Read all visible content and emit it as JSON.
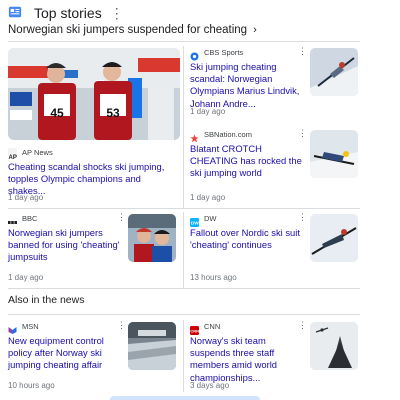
{
  "header": {
    "title": "Top stories",
    "topic": "Norwegian ski jumpers suspended for cheating",
    "chevron": "›"
  },
  "top_cards": [
    {
      "source": "AP News",
      "headline": "Cheating scandal shocks ski jumping, topples Olympic champions and shakes...",
      "time": "1 day ago",
      "bibs": [
        "45",
        "53"
      ]
    },
    {
      "source": "CBS Sports",
      "headline": "Ski jumping cheating scandal: Norwegian Olympians Marius Lindvik, Johann Andre...",
      "time": "1 day ago"
    },
    {
      "source": "SBNation.com",
      "headline": "Blatant CROTCH CHEATING has rocked the ski jumping world",
      "time": "1 day ago"
    },
    {
      "source": "BBC",
      "headline": "Norwegian ski jumpers banned for using 'cheating' jumpsuits",
      "time": "1 day ago"
    },
    {
      "source": "DW",
      "headline": "Fallout over Nordic ski suit 'cheating' continues",
      "time": "13 hours ago"
    }
  ],
  "also_title": "Also in the news",
  "also_cards": [
    {
      "source": "MSN",
      "headline": "New equipment control policy after Norway ski jumping cheating affair",
      "time": "10 hours ago"
    },
    {
      "source": "CNN",
      "headline": "Norway's ski team suspends three staff members amid world championships...",
      "time": "3 days ago"
    }
  ],
  "icons": {
    "kebab": "⋮",
    "news": "newspaper-icon"
  },
  "colors": {
    "link": "#1a0dab",
    "news_icon": "#4285f4",
    "cbs": "#1a73e8",
    "sbnation": "#e8453c",
    "cnn": "#cc0000"
  }
}
